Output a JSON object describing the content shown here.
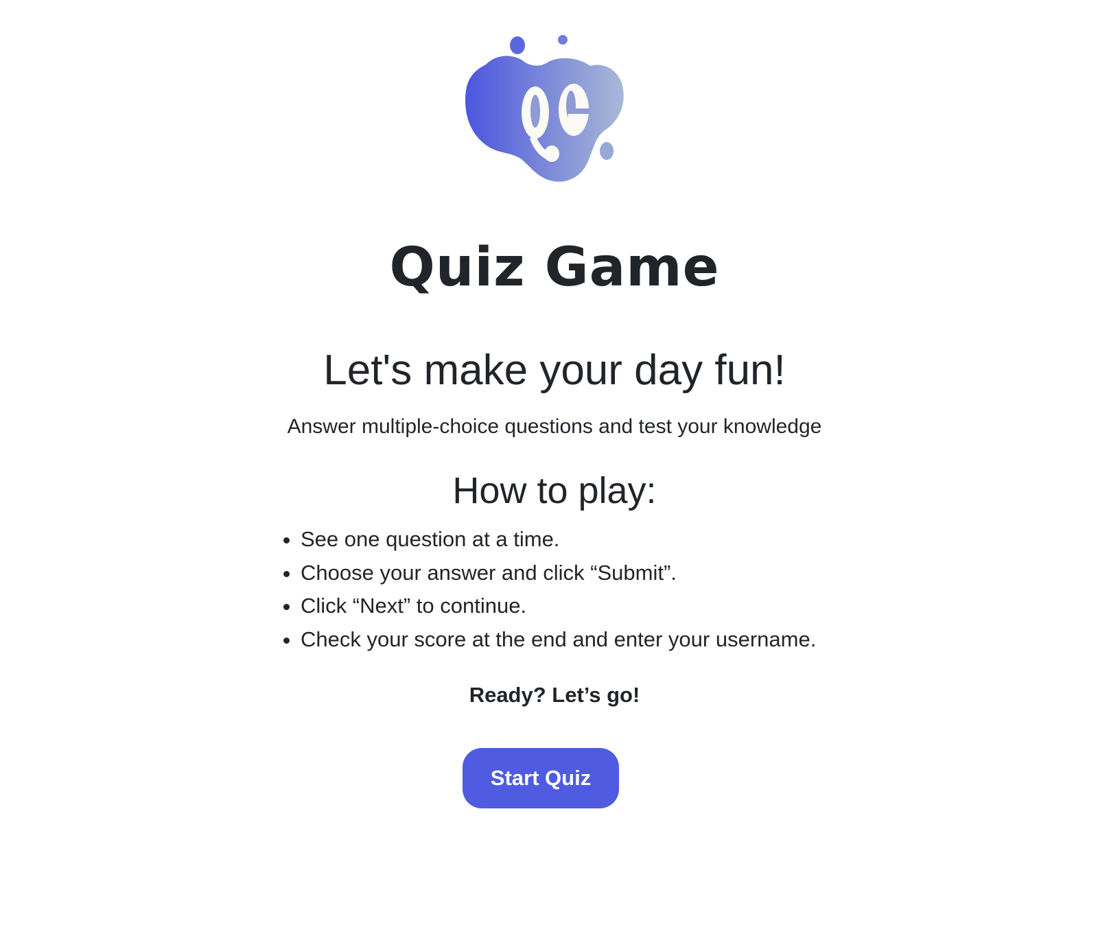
{
  "logo": {
    "icon": "quiz-game-logo",
    "letters": "QG",
    "gradient_start": "#4c55e0",
    "gradient_end": "#a7b7d6"
  },
  "title": "Quiz Game",
  "tagline": "Let's make your day fun!",
  "subtitle": "Answer multiple-choice questions and test your knowledge",
  "how_to": {
    "heading": "How to play:",
    "rules": [
      "See one question at a time.",
      "Choose your answer and click “Submit”.",
      "Click “Next” to continue.",
      "Check your score at the end and enter your username."
    ]
  },
  "ready_text": "Ready? Let’s go!",
  "start_button": {
    "label": "Start Quiz",
    "color": "#4f5be0"
  }
}
